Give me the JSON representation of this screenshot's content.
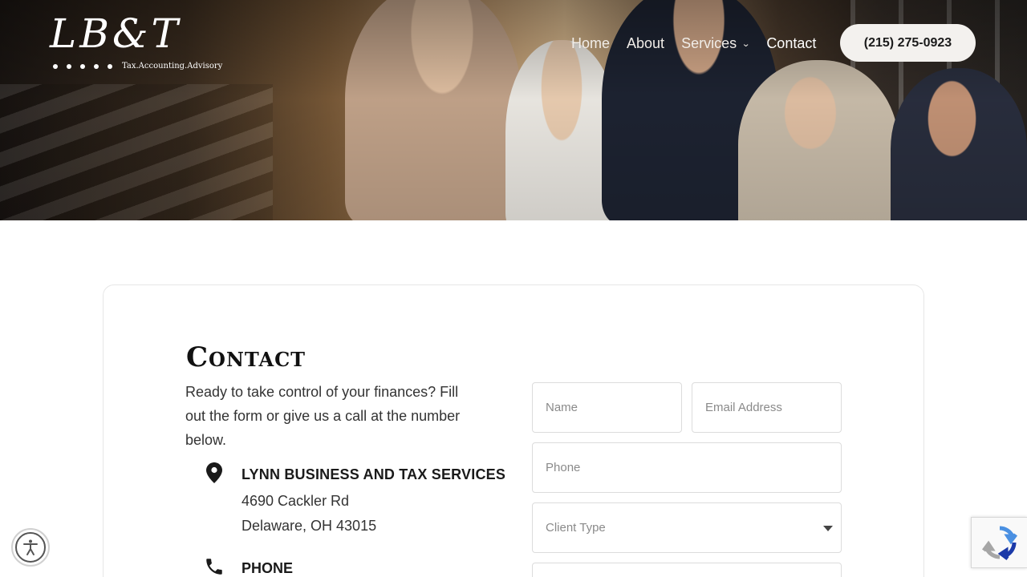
{
  "logo": {
    "script": "LB&T",
    "tagline": "Tax.Accounting.Advisory"
  },
  "nav": {
    "items": [
      {
        "label": "Home"
      },
      {
        "label": "About"
      },
      {
        "label": "Services"
      },
      {
        "label": "Contact"
      }
    ],
    "phone_button": "(215) 275-0923"
  },
  "contact": {
    "title": "Contact",
    "intro": "Ready to take control of your finances? Fill out the form or give us a call at the number below.",
    "business_name": "LYNN BUSINESS AND TAX SERVICES",
    "address_line1": "4690 Cackler Rd",
    "address_line2": "Delaware, OH 43015",
    "phone_heading": "PHONE"
  },
  "form": {
    "name_placeholder": "Name",
    "email_placeholder": "Email Address",
    "phone_placeholder": "Phone",
    "client_type_placeholder": "Client Type"
  },
  "colors": {
    "accent_button_bg": "#f3f1ee",
    "text_dark": "#111111"
  },
  "icons": [
    "map-pin-icon",
    "phone-icon",
    "accessibility-icon",
    "recaptcha-icon",
    "chevron-down-icon"
  ]
}
